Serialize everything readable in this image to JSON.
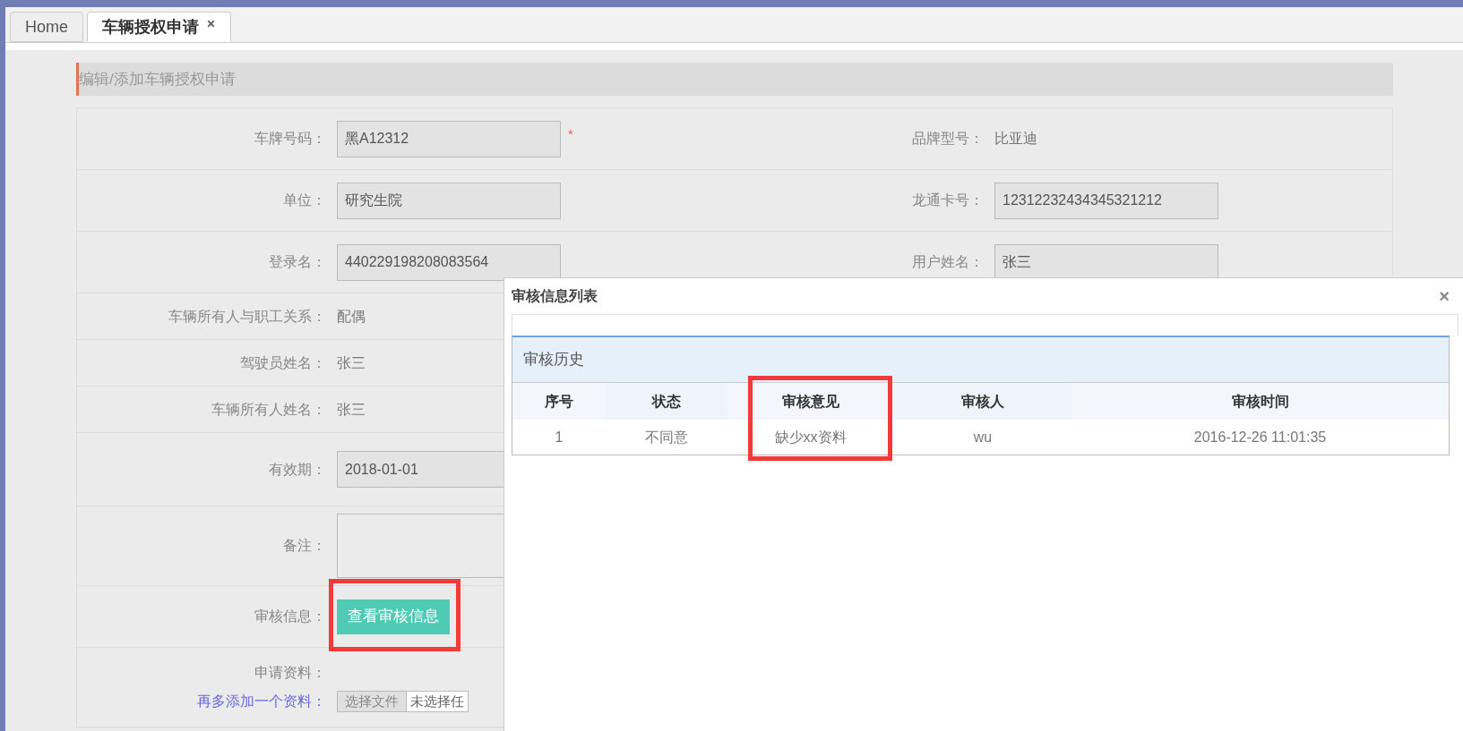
{
  "tabs": [
    {
      "label": "Home",
      "selected": false,
      "closable": false
    },
    {
      "label": "车辆授权申请",
      "selected": true,
      "closable": true
    }
  ],
  "form_title": "编辑/添加车辆授权申请",
  "form_rows": [
    {
      "left": {
        "label": "车牌号码：",
        "kind": "input",
        "value": "黑A12312",
        "required_mark": "*"
      },
      "right": {
        "label": "品牌型号：",
        "kind": "text",
        "value": "比亚迪"
      }
    },
    {
      "left": {
        "label": "单位：",
        "kind": "input",
        "value": "研究生院"
      },
      "right": {
        "label": "龙通卡号：",
        "kind": "input",
        "value": "12312232434345321212"
      }
    },
    {
      "left": {
        "label": "登录名：",
        "kind": "input",
        "value": "440229198208083564"
      },
      "right": {
        "label": "用户姓名：",
        "kind": "input",
        "value": "张三"
      }
    },
    {
      "left": {
        "label": "车辆所有人与职工关系：",
        "kind": "text",
        "value": "配偶"
      }
    },
    {
      "left": {
        "label": "驾驶员姓名：",
        "kind": "text",
        "value": "张三"
      }
    },
    {
      "left": {
        "label": "车辆所有人姓名：",
        "kind": "text",
        "value": "张三"
      }
    },
    {
      "left": {
        "label": "有效期：",
        "kind": "input",
        "value": "2018-01-01"
      }
    },
    {
      "left": {
        "label": "备注：",
        "kind": "textarea"
      }
    },
    {
      "left": {
        "label": "审核信息：",
        "kind": "button",
        "value": "查看审核信息",
        "highlighted": true
      }
    },
    {
      "left": {
        "label": "申请资料：",
        "kind": "file",
        "link": "再多添加一个资料：",
        "button": "选择文件",
        "value": "未选择任"
      }
    }
  ],
  "dialog": {
    "title": "审核信息列表",
    "close": "×",
    "panel_title": "审核历史",
    "columns": [
      {
        "label": "序号",
        "highlighted": false
      },
      {
        "label": "状态",
        "highlighted": false
      },
      {
        "label": "审核意见",
        "highlighted": true
      },
      {
        "label": "审核人",
        "highlighted": false
      },
      {
        "label": "审核时间",
        "highlighted": false
      }
    ],
    "rows": [
      [
        "1",
        "不同意",
        "缺少xx资料",
        "wu",
        "2016-12-26 11:01:35"
      ]
    ]
  }
}
